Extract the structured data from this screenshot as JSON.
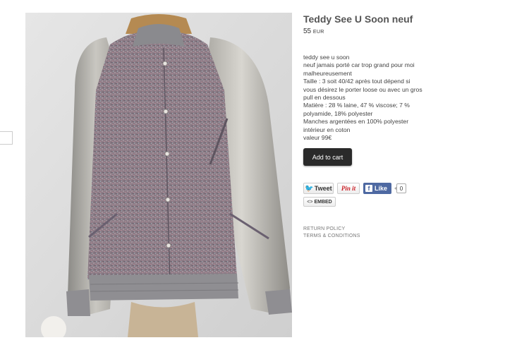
{
  "product": {
    "title": "Teddy See U Soon neuf",
    "price_value": "55",
    "price_currency": "EUR",
    "description": [
      "teddy see u soon",
      "neuf jamais porté car trop grand pour moi",
      "malheureusement",
      "Taille : 3 soit 40/42 après tout dépend si",
      "vous désirez le porter loose ou avec un gros",
      "pull en dessous",
      "Matière : 28 % laine, 47 % viscose; 7 %",
      "polyamide, 18% polyester",
      "Manches argentées en 100% polyester",
      "intérieur en coton",
      "valeur 99€"
    ],
    "image_icon": "jacket-photo"
  },
  "actions": {
    "add_to_cart_label": "Add to cart"
  },
  "social": {
    "tweet_label": "Tweet",
    "pin_label": "Pin it",
    "like_label": "Like",
    "like_count": "0",
    "embed_label": "EMBED"
  },
  "footer_links": {
    "return_policy": "RETURN POLICY",
    "terms": "TERMS & CONDITIONS"
  }
}
